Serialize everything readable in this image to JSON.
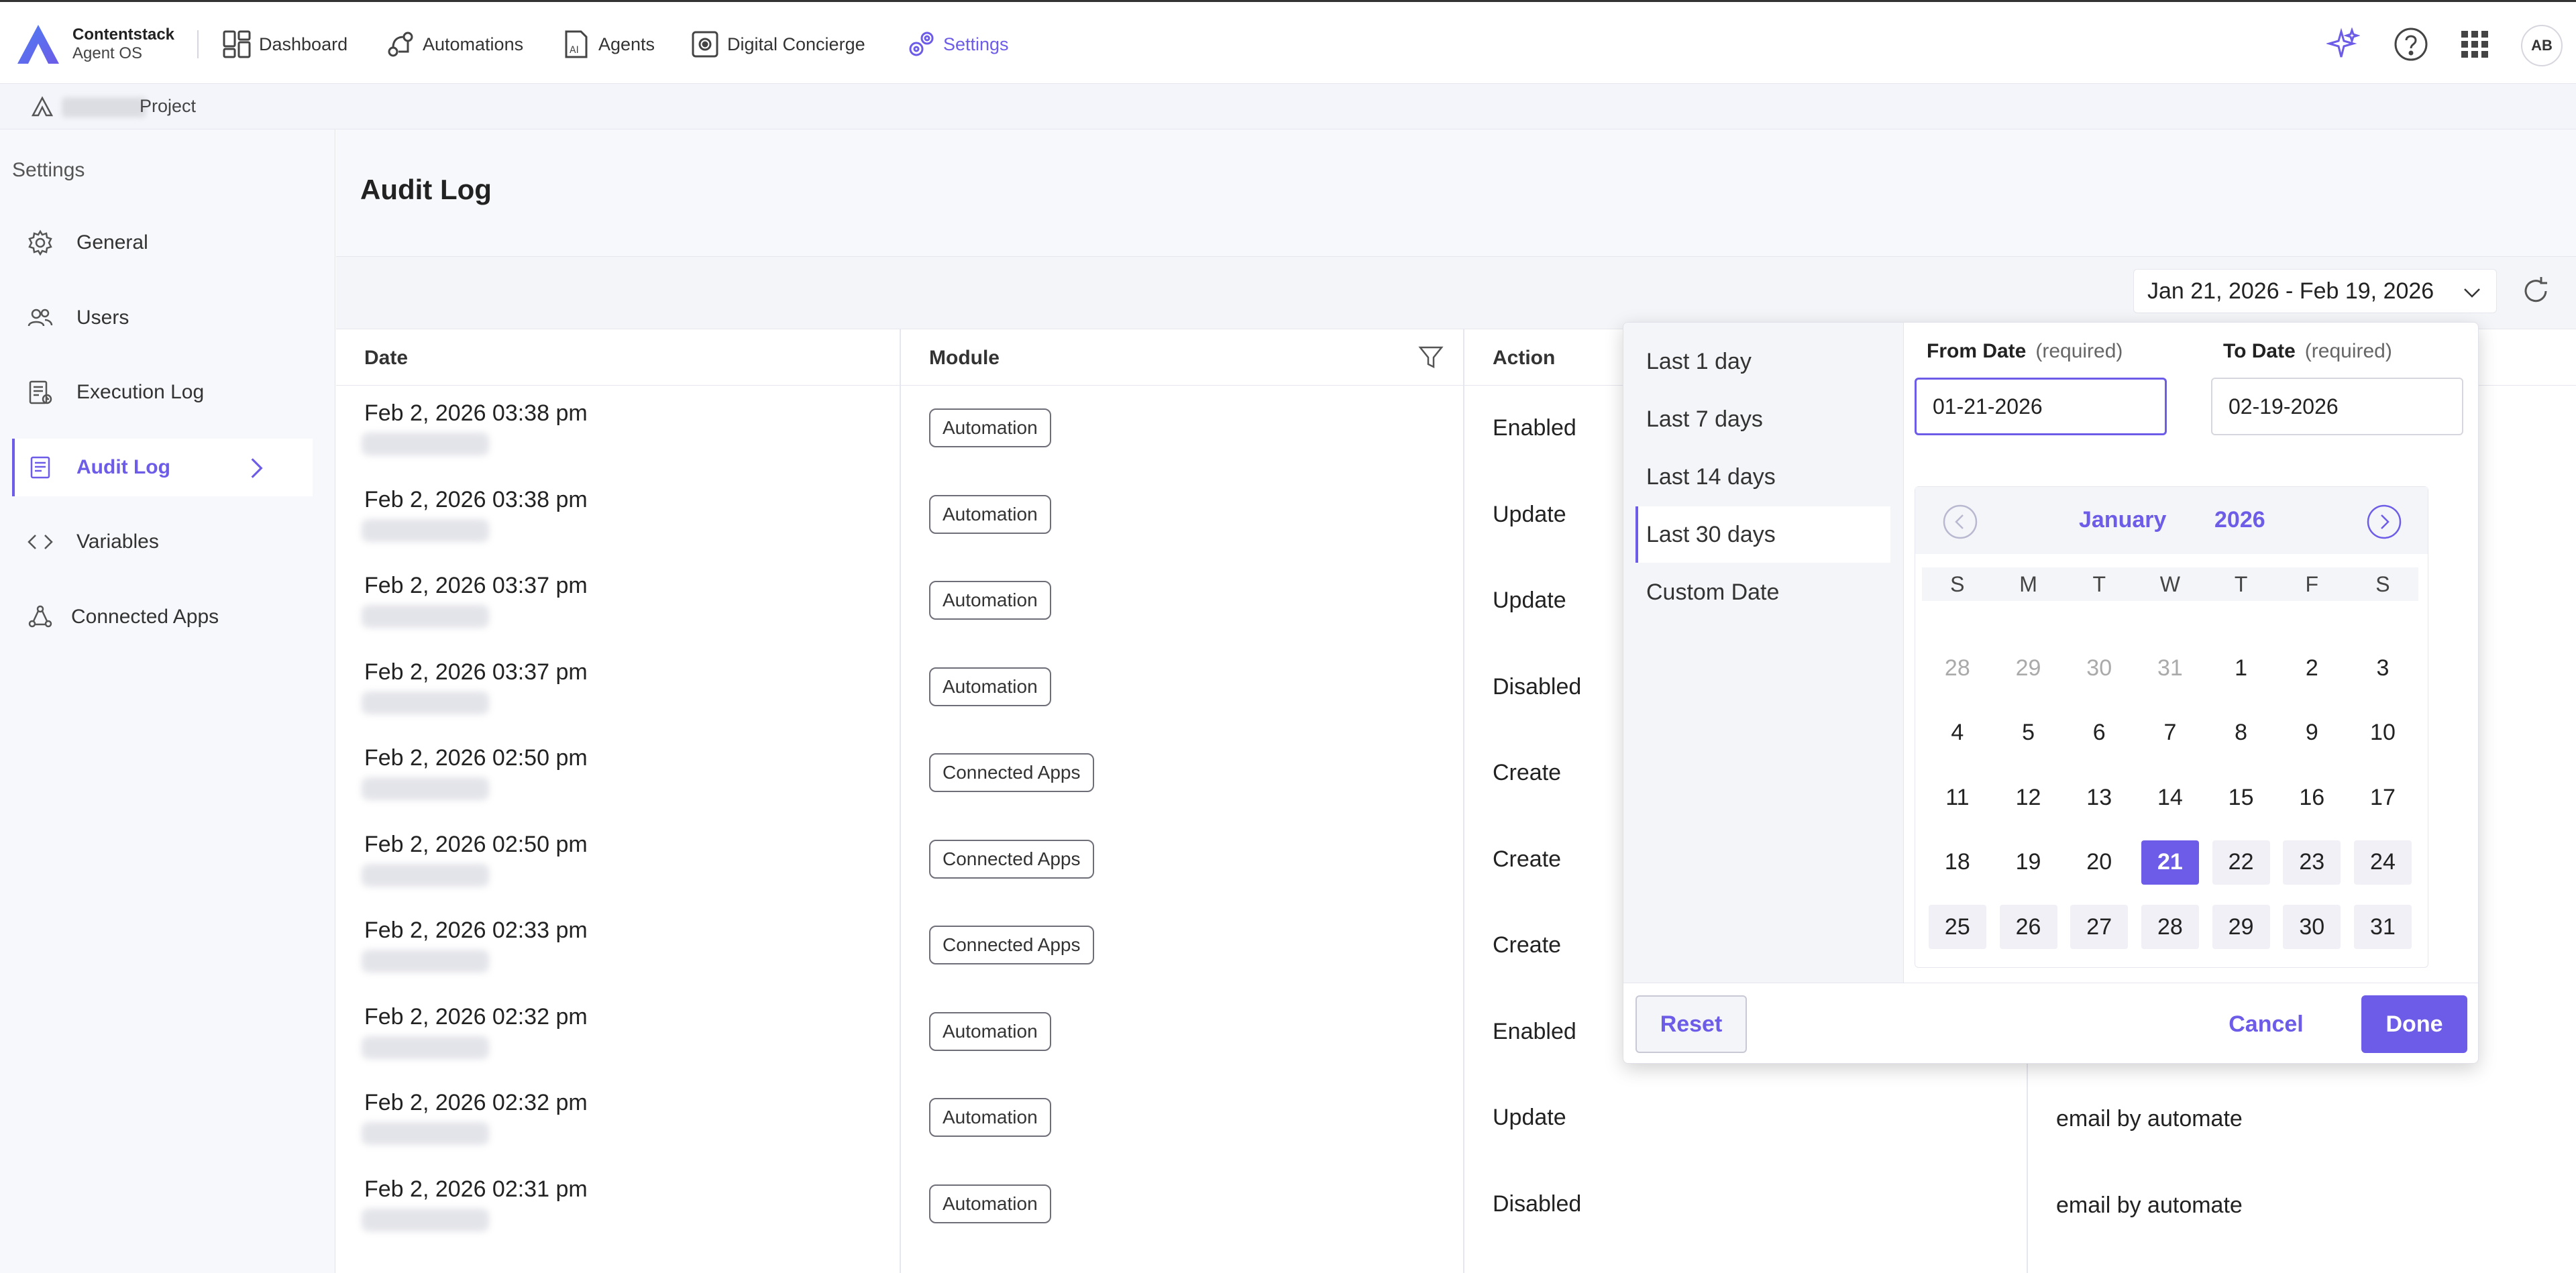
{
  "brand": {
    "name": "Contentstack",
    "sub": "Agent OS",
    "accent": "#6c5ce7"
  },
  "nav": {
    "dashboard": "Dashboard",
    "automations": "Automations",
    "agents": "Agents",
    "concierge": "Digital Concierge",
    "settings": "Settings"
  },
  "header_icons": [
    "sparkle-icon",
    "help-icon",
    "app-grid-icon"
  ],
  "user": {
    "initials": "AB"
  },
  "breadcrumb": {
    "project": "Project"
  },
  "sidebar": {
    "title": "Settings",
    "items": [
      {
        "label": "General",
        "icon": "gear-icon"
      },
      {
        "label": "Users",
        "icon": "users-icon"
      },
      {
        "label": "Execution Log",
        "icon": "execution-log-icon"
      },
      {
        "label": "Audit Log",
        "icon": "audit-log-icon",
        "active": true
      },
      {
        "label": "Variables",
        "icon": "code-icon"
      },
      {
        "label": "Connected Apps",
        "icon": "connected-apps-icon"
      }
    ]
  },
  "page": {
    "title": "Audit Log"
  },
  "date_range": {
    "label": "Jan 21, 2026 - Feb 19, 2026"
  },
  "table": {
    "columns": {
      "date": "Date",
      "module": "Module",
      "action": "Action"
    },
    "rows": [
      {
        "date": "Feb 2, 2026 03:38 pm",
        "module": "Automation",
        "action": "Enabled",
        "extra": ""
      },
      {
        "date": "Feb 2, 2026 03:38 pm",
        "module": "Automation",
        "action": "Update",
        "extra": ""
      },
      {
        "date": "Feb 2, 2026 03:37 pm",
        "module": "Automation",
        "action": "Update",
        "extra": ""
      },
      {
        "date": "Feb 2, 2026 03:37 pm",
        "module": "Automation",
        "action": "Disabled",
        "extra": ""
      },
      {
        "date": "Feb 2, 2026 02:50 pm",
        "module": "Connected Apps",
        "action": "Create",
        "extra": ""
      },
      {
        "date": "Feb 2, 2026 02:50 pm",
        "module": "Connected Apps",
        "action": "Create",
        "extra": ""
      },
      {
        "date": "Feb 2, 2026 02:33 pm",
        "module": "Connected Apps",
        "action": "Create",
        "extra": ""
      },
      {
        "date": "Feb 2, 2026 02:32 pm",
        "module": "Automation",
        "action": "Enabled",
        "extra": ""
      },
      {
        "date": "Feb 2, 2026 02:32 pm",
        "module": "Automation",
        "action": "Update",
        "extra": "email by automate"
      },
      {
        "date": "Feb 2, 2026 02:31 pm",
        "module": "Automation",
        "action": "Disabled",
        "extra": "email by automate"
      }
    ]
  },
  "date_picker": {
    "presets": [
      "Last 1 day",
      "Last 7 days",
      "Last 14 days",
      "Last 30 days",
      "Custom Date"
    ],
    "active_preset": "Last 30 days",
    "from_label": "From Date",
    "to_label": "To Date",
    "required_text": "(required)",
    "from_value": "01-21-2026",
    "to_value": "02-19-2026",
    "calendar": {
      "month": "January",
      "year": "2026",
      "weekdays": [
        "S",
        "M",
        "T",
        "W",
        "T",
        "F",
        "S"
      ],
      "days": [
        {
          "d": "28",
          "muted": true
        },
        {
          "d": "29",
          "muted": true
        },
        {
          "d": "30",
          "muted": true
        },
        {
          "d": "31",
          "muted": true
        },
        {
          "d": "1"
        },
        {
          "d": "2"
        },
        {
          "d": "3"
        },
        {
          "d": "4"
        },
        {
          "d": "5"
        },
        {
          "d": "6"
        },
        {
          "d": "7"
        },
        {
          "d": "8"
        },
        {
          "d": "9"
        },
        {
          "d": "10"
        },
        {
          "d": "11"
        },
        {
          "d": "12"
        },
        {
          "d": "13"
        },
        {
          "d": "14"
        },
        {
          "d": "15"
        },
        {
          "d": "16"
        },
        {
          "d": "17"
        },
        {
          "d": "18"
        },
        {
          "d": "19"
        },
        {
          "d": "20"
        },
        {
          "d": "21",
          "selected": true
        },
        {
          "d": "22",
          "inrange": true
        },
        {
          "d": "23",
          "inrange": true
        },
        {
          "d": "24",
          "inrange": true
        },
        {
          "d": "25",
          "inrange": true
        },
        {
          "d": "26",
          "inrange": true
        },
        {
          "d": "27",
          "inrange": true
        },
        {
          "d": "28",
          "inrange": true
        },
        {
          "d": "29",
          "inrange": true
        },
        {
          "d": "30",
          "inrange": true
        },
        {
          "d": "31",
          "inrange": true
        }
      ]
    },
    "reset": "Reset",
    "cancel": "Cancel",
    "done": "Done"
  }
}
